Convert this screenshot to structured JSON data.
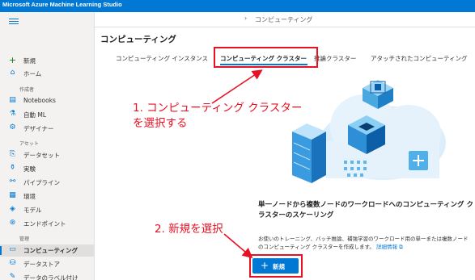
{
  "app": {
    "title": "Microsoft Azure Machine Learning Studio"
  },
  "breadcrumb": {
    "current": "コンピューティング"
  },
  "sidebar": {
    "items": [
      {
        "label": "新規",
        "icon": "plus-icon"
      },
      {
        "label": "ホーム",
        "icon": "home-icon"
      },
      {
        "section": "作成者"
      },
      {
        "label": "Notebooks",
        "icon": "notebook-icon"
      },
      {
        "label": "自動 ML",
        "icon": "automl-icon"
      },
      {
        "label": "デザイナー",
        "icon": "designer-icon"
      },
      {
        "section": "アセット"
      },
      {
        "label": "データセット",
        "icon": "dataset-icon"
      },
      {
        "label": "実験",
        "icon": "experiment-icon"
      },
      {
        "label": "パイプライン",
        "icon": "pipeline-icon"
      },
      {
        "label": "環境",
        "icon": "environment-icon"
      },
      {
        "label": "モデル",
        "icon": "model-icon"
      },
      {
        "label": "エンドポイント",
        "icon": "endpoint-icon"
      },
      {
        "section": "管理"
      },
      {
        "label": "コンピューティング",
        "icon": "compute-icon",
        "active": true
      },
      {
        "label": "データストア",
        "icon": "datastore-icon"
      },
      {
        "label": "データのラベル付け",
        "icon": "labeling-icon"
      }
    ]
  },
  "main": {
    "title": "コンピューティング",
    "tabs": [
      {
        "label": "コンピューティング インスタンス"
      },
      {
        "label": "コンピューティング クラスター",
        "active": true
      },
      {
        "label": "推論クラスター"
      },
      {
        "label": "アタッチされたコンピューティング"
      }
    ],
    "promo": {
      "title": "単一ノードから複数ノードのワークロードへのコンピューティング クラスターのスケーリング",
      "description": "お使いのトレーニング、バッチ推論、補強学習のワークロード用の単一または複数ノードのコンピューティング クラスターを作成します。",
      "link": "詳細情報",
      "new_button": "新規"
    }
  },
  "annotations": {
    "step1_line1": "1. コンピューティング クラスター",
    "step1_line2": "を選択する",
    "step2": "2. 新規を選択"
  },
  "colors": {
    "accent": "#0078d4",
    "annotation": "#e81123"
  }
}
